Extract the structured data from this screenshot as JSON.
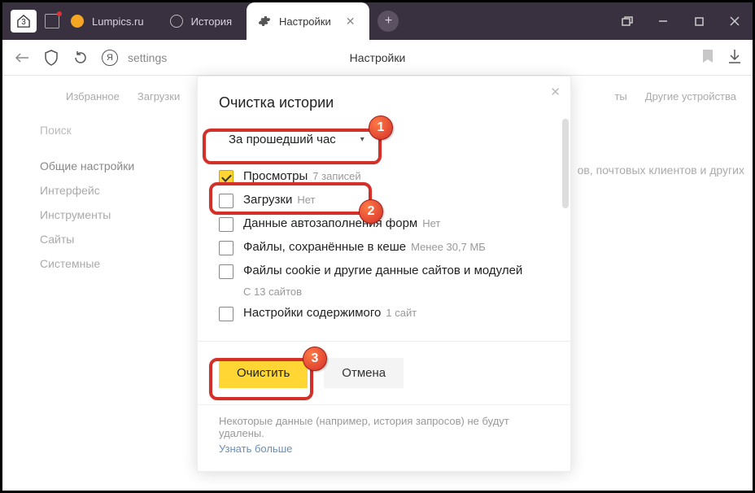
{
  "titlebar": {
    "home_count": "3",
    "tabs": [
      {
        "label": "Lumpics.ru"
      },
      {
        "label": "История"
      },
      {
        "label": "Настройки"
      }
    ]
  },
  "toolbar": {
    "protect_letter": "Я",
    "url_text": "settings",
    "page_title": "Настройки"
  },
  "bg": {
    "topnav": [
      "Избранное",
      "Загрузки"
    ],
    "topnav_right": [
      "ты",
      "Другие устройства"
    ],
    "search_placeholder": "Поиск",
    "side_items": [
      "Общие настройки",
      "Интерфейс",
      "Инструменты",
      "Сайты",
      "Системные"
    ],
    "right_hint": "ов, почтовых клиентов и других"
  },
  "dialog": {
    "title": "Очистка истории",
    "range_label": "За прошедший час",
    "options": [
      {
        "label": "Просмотры",
        "sub": "7 записей",
        "checked": true
      },
      {
        "label": "Загрузки",
        "sub": "Нет",
        "checked": false
      },
      {
        "label": "Данные автозаполнения форм",
        "sub": "Нет",
        "checked": false
      },
      {
        "label": "Файлы, сохранённые в кеше",
        "sub": "Менее 30,7 МБ",
        "checked": false
      },
      {
        "label": "Файлы cookie и другие данные сайтов и модулей",
        "sub_block": "С 13 сайтов",
        "checked": false
      },
      {
        "label": "Настройки содержимого",
        "sub": "1 сайт",
        "checked": false
      }
    ],
    "clear_btn": "Очистить",
    "cancel_btn": "Отмена",
    "footer_text": "Некоторые данные (например, история запросов) не будут удалены.",
    "footer_link": "Узнать больше"
  },
  "annotations": {
    "b1": "1",
    "b2": "2",
    "b3": "3"
  }
}
